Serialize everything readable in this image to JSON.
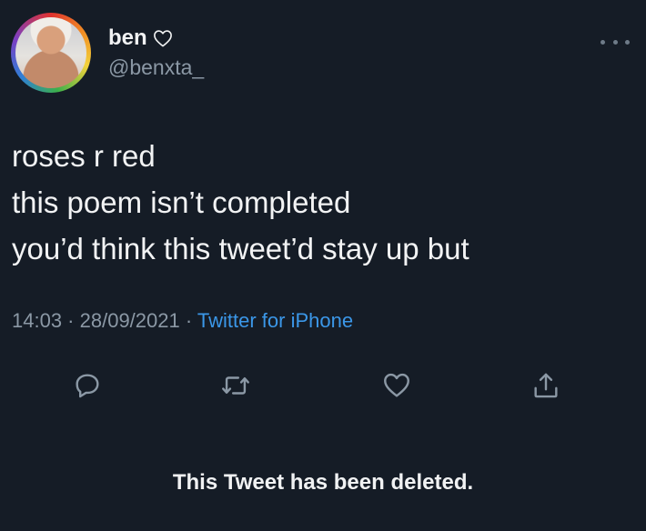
{
  "profile": {
    "name": "ben",
    "handle": "@benxta_"
  },
  "tweet": {
    "lines": [
      "roses r red",
      "this poem isn’t completed",
      "you’d think this tweet’d stay up but"
    ],
    "time": "14:03",
    "date": "28/09/2021",
    "separator": " · ",
    "source": "Twitter for iPhone"
  },
  "actions": {
    "reply_icon": "reply-icon",
    "retweet_icon": "retweet-icon",
    "like_icon": "heart-icon",
    "share_icon": "share-icon"
  },
  "status": {
    "deleted_message": "This Tweet has been deleted."
  },
  "colors": {
    "background": "#151c26",
    "text": "#f2f3f4",
    "muted": "#8b98a5",
    "link": "#3b97e8"
  }
}
